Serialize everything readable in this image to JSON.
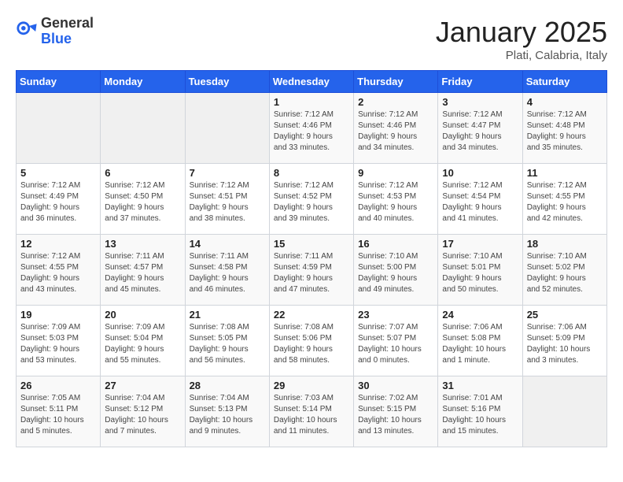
{
  "header": {
    "logo": {
      "general": "General",
      "blue": "Blue"
    },
    "title": "January 2025",
    "subtitle": "Plati, Calabria, Italy"
  },
  "days_of_week": [
    "Sunday",
    "Monday",
    "Tuesday",
    "Wednesday",
    "Thursday",
    "Friday",
    "Saturday"
  ],
  "weeks": [
    [
      {
        "day": "",
        "info": ""
      },
      {
        "day": "",
        "info": ""
      },
      {
        "day": "",
        "info": ""
      },
      {
        "day": "1",
        "info": "Sunrise: 7:12 AM\nSunset: 4:46 PM\nDaylight: 9 hours\nand 33 minutes."
      },
      {
        "day": "2",
        "info": "Sunrise: 7:12 AM\nSunset: 4:46 PM\nDaylight: 9 hours\nand 34 minutes."
      },
      {
        "day": "3",
        "info": "Sunrise: 7:12 AM\nSunset: 4:47 PM\nDaylight: 9 hours\nand 34 minutes."
      },
      {
        "day": "4",
        "info": "Sunrise: 7:12 AM\nSunset: 4:48 PM\nDaylight: 9 hours\nand 35 minutes."
      }
    ],
    [
      {
        "day": "5",
        "info": "Sunrise: 7:12 AM\nSunset: 4:49 PM\nDaylight: 9 hours\nand 36 minutes."
      },
      {
        "day": "6",
        "info": "Sunrise: 7:12 AM\nSunset: 4:50 PM\nDaylight: 9 hours\nand 37 minutes."
      },
      {
        "day": "7",
        "info": "Sunrise: 7:12 AM\nSunset: 4:51 PM\nDaylight: 9 hours\nand 38 minutes."
      },
      {
        "day": "8",
        "info": "Sunrise: 7:12 AM\nSunset: 4:52 PM\nDaylight: 9 hours\nand 39 minutes."
      },
      {
        "day": "9",
        "info": "Sunrise: 7:12 AM\nSunset: 4:53 PM\nDaylight: 9 hours\nand 40 minutes."
      },
      {
        "day": "10",
        "info": "Sunrise: 7:12 AM\nSunset: 4:54 PM\nDaylight: 9 hours\nand 41 minutes."
      },
      {
        "day": "11",
        "info": "Sunrise: 7:12 AM\nSunset: 4:55 PM\nDaylight: 9 hours\nand 42 minutes."
      }
    ],
    [
      {
        "day": "12",
        "info": "Sunrise: 7:12 AM\nSunset: 4:55 PM\nDaylight: 9 hours\nand 43 minutes."
      },
      {
        "day": "13",
        "info": "Sunrise: 7:11 AM\nSunset: 4:57 PM\nDaylight: 9 hours\nand 45 minutes."
      },
      {
        "day": "14",
        "info": "Sunrise: 7:11 AM\nSunset: 4:58 PM\nDaylight: 9 hours\nand 46 minutes."
      },
      {
        "day": "15",
        "info": "Sunrise: 7:11 AM\nSunset: 4:59 PM\nDaylight: 9 hours\nand 47 minutes."
      },
      {
        "day": "16",
        "info": "Sunrise: 7:10 AM\nSunset: 5:00 PM\nDaylight: 9 hours\nand 49 minutes."
      },
      {
        "day": "17",
        "info": "Sunrise: 7:10 AM\nSunset: 5:01 PM\nDaylight: 9 hours\nand 50 minutes."
      },
      {
        "day": "18",
        "info": "Sunrise: 7:10 AM\nSunset: 5:02 PM\nDaylight: 9 hours\nand 52 minutes."
      }
    ],
    [
      {
        "day": "19",
        "info": "Sunrise: 7:09 AM\nSunset: 5:03 PM\nDaylight: 9 hours\nand 53 minutes."
      },
      {
        "day": "20",
        "info": "Sunrise: 7:09 AM\nSunset: 5:04 PM\nDaylight: 9 hours\nand 55 minutes."
      },
      {
        "day": "21",
        "info": "Sunrise: 7:08 AM\nSunset: 5:05 PM\nDaylight: 9 hours\nand 56 minutes."
      },
      {
        "day": "22",
        "info": "Sunrise: 7:08 AM\nSunset: 5:06 PM\nDaylight: 9 hours\nand 58 minutes."
      },
      {
        "day": "23",
        "info": "Sunrise: 7:07 AM\nSunset: 5:07 PM\nDaylight: 10 hours\nand 0 minutes."
      },
      {
        "day": "24",
        "info": "Sunrise: 7:06 AM\nSunset: 5:08 PM\nDaylight: 10 hours\nand 1 minute."
      },
      {
        "day": "25",
        "info": "Sunrise: 7:06 AM\nSunset: 5:09 PM\nDaylight: 10 hours\nand 3 minutes."
      }
    ],
    [
      {
        "day": "26",
        "info": "Sunrise: 7:05 AM\nSunset: 5:11 PM\nDaylight: 10 hours\nand 5 minutes."
      },
      {
        "day": "27",
        "info": "Sunrise: 7:04 AM\nSunset: 5:12 PM\nDaylight: 10 hours\nand 7 minutes."
      },
      {
        "day": "28",
        "info": "Sunrise: 7:04 AM\nSunset: 5:13 PM\nDaylight: 10 hours\nand 9 minutes."
      },
      {
        "day": "29",
        "info": "Sunrise: 7:03 AM\nSunset: 5:14 PM\nDaylight: 10 hours\nand 11 minutes."
      },
      {
        "day": "30",
        "info": "Sunrise: 7:02 AM\nSunset: 5:15 PM\nDaylight: 10 hours\nand 13 minutes."
      },
      {
        "day": "31",
        "info": "Sunrise: 7:01 AM\nSunset: 5:16 PM\nDaylight: 10 hours\nand 15 minutes."
      },
      {
        "day": "",
        "info": ""
      }
    ]
  ]
}
